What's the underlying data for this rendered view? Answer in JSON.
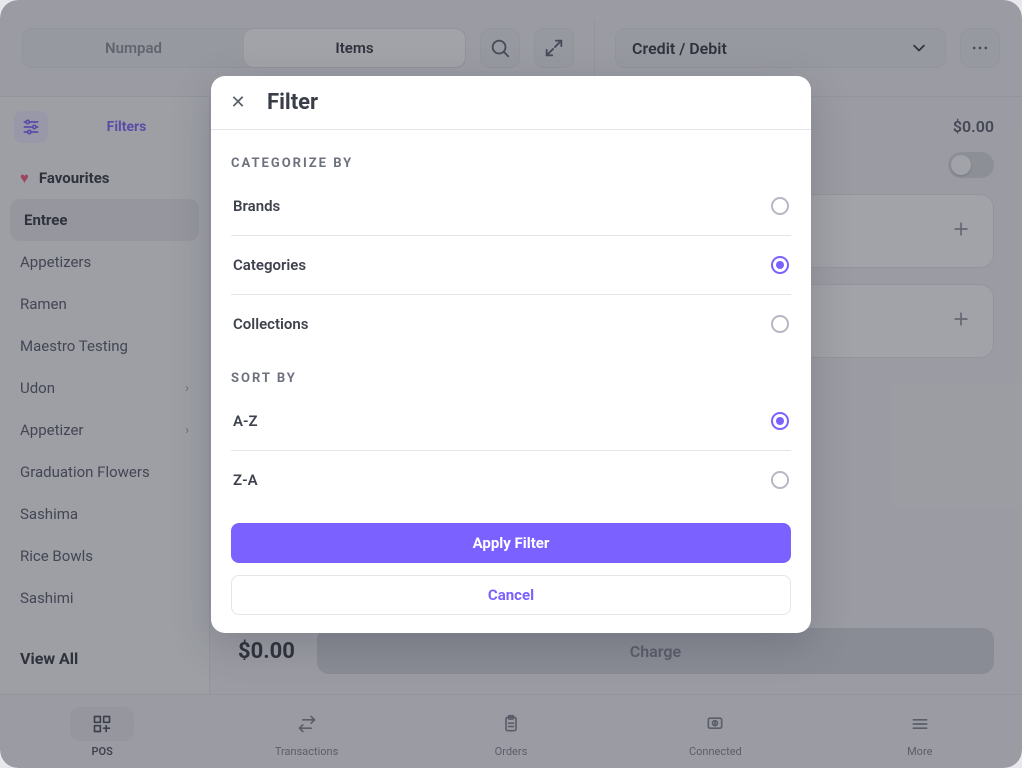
{
  "topbar": {
    "tabs": [
      {
        "label": "Numpad",
        "active": false
      },
      {
        "label": "Items",
        "active": true
      }
    ],
    "payMethod": "Credit / Debit"
  },
  "sidebar": {
    "filtersLabel": "Filters",
    "favourites": "Favourites",
    "items": [
      {
        "label": "Entree"
      },
      {
        "label": "Appetizers"
      },
      {
        "label": "Ramen"
      },
      {
        "label": "Maestro Testing"
      },
      {
        "label": "Udon",
        "hasChildren": true
      },
      {
        "label": "Appetizer",
        "hasChildren": true
      },
      {
        "label": "Graduation Flowers"
      },
      {
        "label": "Sashima"
      },
      {
        "label": "Rice Bowls"
      },
      {
        "label": "Sashimi"
      }
    ],
    "viewAll": "View All"
  },
  "right": {
    "topTotal": "$0.00",
    "cards": [
      {
        "label": ""
      },
      {
        "label": ""
      }
    ],
    "chargeTotal": "$0.00",
    "chargeLabel": "Charge"
  },
  "bottomnav": {
    "items": [
      {
        "label": "POS",
        "icon": "grid"
      },
      {
        "label": "Transactions",
        "icon": "swap"
      },
      {
        "label": "Orders",
        "icon": "clipboard"
      },
      {
        "label": "Connected",
        "icon": "device"
      },
      {
        "label": "More",
        "icon": "menu"
      }
    ]
  },
  "modal": {
    "title": "Filter",
    "sections": [
      {
        "title": "Categorize By",
        "options": [
          {
            "label": "Brands",
            "checked": false
          },
          {
            "label": "Categories",
            "checked": true
          },
          {
            "label": "Collections",
            "checked": false
          }
        ]
      },
      {
        "title": "Sort By",
        "options": [
          {
            "label": "A-Z",
            "checked": true
          },
          {
            "label": "Z-A",
            "checked": false
          }
        ]
      }
    ],
    "apply": "Apply Filter",
    "cancel": "Cancel"
  }
}
